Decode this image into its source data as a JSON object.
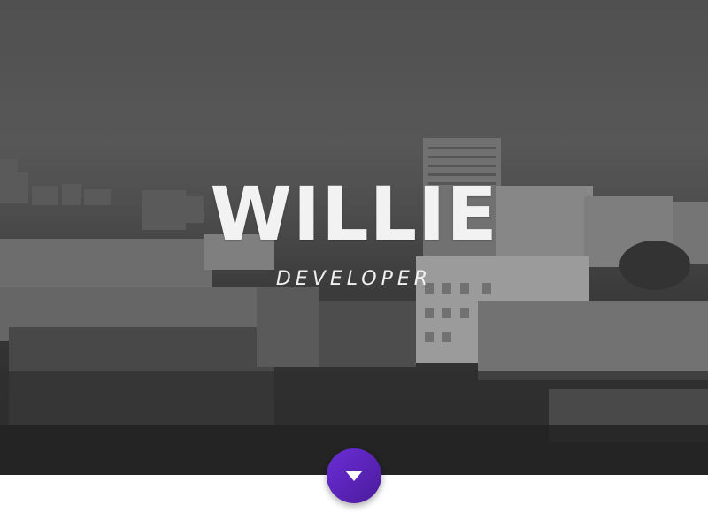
{
  "hero": {
    "name": "WILLIE",
    "role": "DEVELOPER"
  },
  "scroll_button": {
    "icon": "chevron-down-icon"
  },
  "colors": {
    "accent": "#5b24b9",
    "text": "#f2f2f2"
  }
}
